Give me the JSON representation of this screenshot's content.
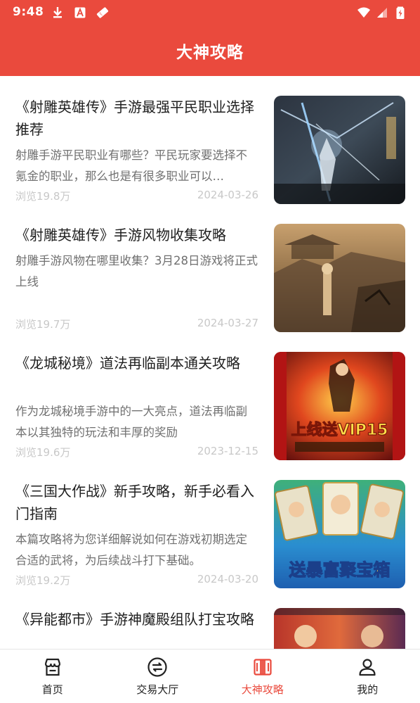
{
  "status_bar": {
    "time": "9:48"
  },
  "header": {
    "title": "大神攻略"
  },
  "articles": [
    {
      "title": "《射雕英雄传》手游最强平民职业选择推荐",
      "summary": "射雕手游平民职业有哪些？平民玩家要选择不氪金的职业，那么也是有很多职业可以…",
      "views": "浏览19.8万",
      "date": "2024-03-26"
    },
    {
      "title": "《射雕英雄传》手游风物收集攻略",
      "summary": "射雕手游风物在哪里收集？3月28日游戏将正式上线",
      "views": "浏览19.7万",
      "date": "2024-03-27"
    },
    {
      "title": "《龙城秘境》道法再临副本通关攻略",
      "summary": "作为龙城秘境手游中的一大亮点，道法再临副本以其独特的玩法和丰厚的奖励",
      "views": "浏览19.6万",
      "date": "2023-12-15",
      "thumb_text": "上线送VIP15"
    },
    {
      "title": "《三国大作战》新手攻略，新手必看入门指南",
      "summary": "本篇攻略将为您详细解说如何在游戏初期选定合适的武将，为后续战斗打下基础。",
      "views": "浏览19.2万",
      "date": "2024-03-20",
      "thumb_text": "送暴富聚宝箱"
    },
    {
      "title": "《异能都市》手游神魔殿组队打宝攻略"
    }
  ],
  "tabs": [
    {
      "label": "首页",
      "icon": "store-icon"
    },
    {
      "label": "交易大厅",
      "icon": "exchange-icon"
    },
    {
      "label": "大神攻略",
      "icon": "guide-book-icon",
      "active": true
    },
    {
      "label": "我的",
      "icon": "user-icon"
    }
  ],
  "colors": {
    "brand": "#ea4a3d",
    "muted": "#c8c8c8"
  }
}
